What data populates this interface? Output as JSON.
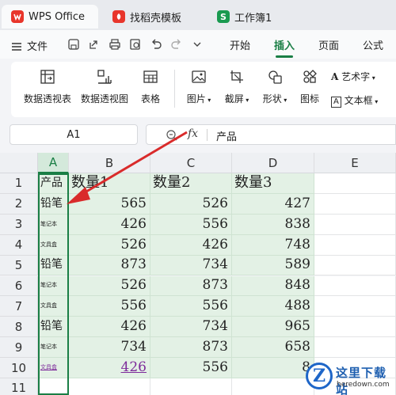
{
  "tabs": [
    {
      "label": "WPS Office",
      "icon": "wps-logo-icon",
      "color": "#e8352b"
    },
    {
      "label": "找稻壳模板",
      "icon": "docer-icon",
      "color": "#e8352b"
    },
    {
      "label": "工作簿1",
      "icon": "spreadsheet-icon",
      "icon_text": "S",
      "color": "#1a9a50"
    }
  ],
  "menubar": {
    "file_label": "文件",
    "tabs": [
      "开始",
      "插入",
      "页面",
      "公式"
    ],
    "active_tab": "插入"
  },
  "ribbon": {
    "items": [
      {
        "label": "数据透视表",
        "icon": "pivot-table-icon"
      },
      {
        "label": "数据透视图",
        "icon": "pivot-chart-icon"
      },
      {
        "label": "表格",
        "icon": "table-icon"
      },
      {
        "label": "图片",
        "icon": "picture-icon",
        "dropdown": true
      },
      {
        "label": "截屏",
        "icon": "screenshot-icon",
        "dropdown": true
      },
      {
        "label": "形状",
        "icon": "shape-icon",
        "dropdown": true
      },
      {
        "label": "图标",
        "icon": "icons-icon"
      }
    ],
    "art_text_label": "艺术字",
    "text_box_label": "文本框"
  },
  "formula_bar": {
    "cell_ref": "A1",
    "fx_label": "fx",
    "value": "产品"
  },
  "sheet": {
    "columns": [
      "A",
      "B",
      "C",
      "D",
      "E"
    ],
    "selected_column": "A",
    "rows": [
      "1",
      "2",
      "3",
      "4",
      "5",
      "6",
      "7",
      "8",
      "9",
      "10",
      "11"
    ],
    "headers": [
      "产品",
      "数量1",
      "数量2",
      "数量3"
    ],
    "data": [
      {
        "product": "铅笔",
        "size": "big",
        "q1": "565",
        "q2": "526",
        "q3": "427"
      },
      {
        "product": "笔记本",
        "size": "small",
        "q1": "426",
        "q2": "556",
        "q3": "838"
      },
      {
        "product": "文具盒",
        "size": "small",
        "q1": "526",
        "q2": "426",
        "q3": "748"
      },
      {
        "product": "铅笔",
        "size": "big",
        "q1": "873",
        "q2": "734",
        "q3": "589"
      },
      {
        "product": "笔记本",
        "size": "small",
        "q1": "526",
        "q2": "873",
        "q3": "848"
      },
      {
        "product": "文具盒",
        "size": "small",
        "q1": "556",
        "q2": "556",
        "q3": "488"
      },
      {
        "product": "铅笔",
        "size": "big",
        "q1": "426",
        "q2": "734",
        "q3": "965"
      },
      {
        "product": "笔记本",
        "size": "small",
        "q1": "734",
        "q2": "873",
        "q3": "658"
      },
      {
        "product": "文具盒",
        "size": "small",
        "link": true,
        "q1": "426",
        "q1_link": true,
        "q2": "556",
        "q3": "8"
      }
    ]
  },
  "watermark": {
    "logo_letter": "Z",
    "title": "这里下载站",
    "url": "heredown.com"
  },
  "colors": {
    "accent": "#1a7e45",
    "selection_fill": "#e3f1e5",
    "arrow": "#d92b2b"
  }
}
